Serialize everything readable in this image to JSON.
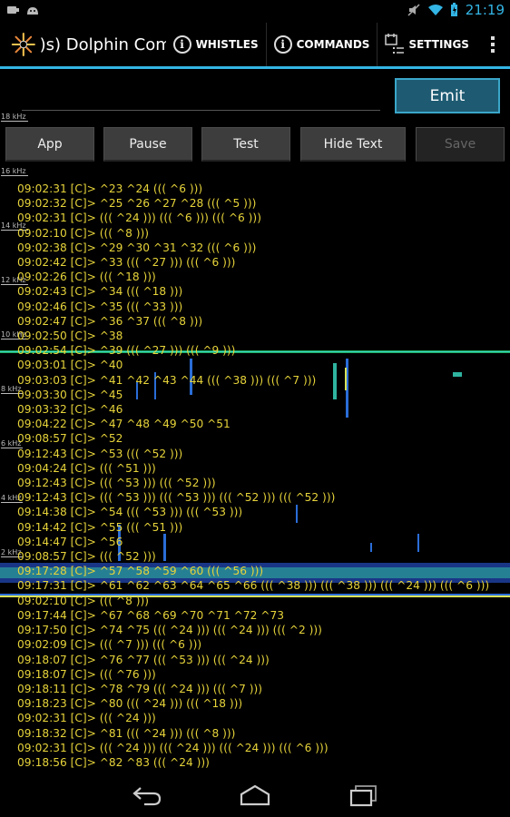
{
  "status_bar": {
    "time": "21:19",
    "left_icons": [
      "usb-debug-icon",
      "android-icon"
    ],
    "right_icons": [
      "mute-icon",
      "wifi-icon",
      "battery-icon"
    ]
  },
  "action_bar": {
    "title": ")s) Dolphin Com...",
    "whistles_label": "WHISTLES",
    "commands_label": "COMMANDS",
    "settings_label": "SETTINGS",
    "accent_color": "#33b5e5"
  },
  "input": {
    "value": ""
  },
  "emit_label": "Emit",
  "toolbar": {
    "app_label": "App",
    "pause_label": "Pause",
    "test_label": "Test",
    "hide_text_label": "Hide Text",
    "save_label": "Save"
  },
  "freq_labels": [
    "18 kHz",
    "16 kHz",
    "14 kHz",
    "12 kHz",
    "10 kHz",
    "8 kHz",
    "6 kHz",
    "4 kHz",
    "2 kHz"
  ],
  "log": [
    "09:02:31 [C]> ^23 ^24 ((( ^6 )))",
    "09:02:32 [C]> ^25 ^26 ^27 ^28 ((( ^5 )))",
    "09:02:31 [C]> ((( ^24 ))) ((( ^6 ))) ((( ^6 )))",
    "09:02:10 [C]> ((( ^8 )))",
    "09:02:38 [C]> ^29 ^30 ^31 ^32 ((( ^6 )))",
    "09:02:42 [C]> ^33 ((( ^27 ))) ((( ^6 )))",
    "09:02:26 [C]> ((( ^18 )))",
    "09:02:43 [C]> ^34 ((( ^18 )))",
    "09:02:46 [C]> ^35 ((( ^33 )))",
    "09:02:47 [C]> ^36 ^37 ((( ^8 )))",
    "09:02:50 [C]> ^38",
    "09:02:54 [C]> ^39 ((( ^27 ))) ((( ^9 )))",
    "09:03:01 [C]> ^40",
    "09:03:03 [C]> ^41 ^42 ^43 ^44 ((( ^38 ))) ((( ^7 )))",
    "09:03:30 [C]> ^45",
    "09:03:32 [C]> ^46",
    "09:04:22 [C]> ^47 ^48 ^49 ^50 ^51",
    "09:08:57 [C]> ^52",
    "09:12:43 [C]> ^53 ((( ^52 )))",
    "09:04:24 [C]> ((( ^51 )))",
    "09:12:43 [C]> ((( ^53 ))) ((( ^52 )))",
    "09:12:43 [C]> ((( ^53 ))) ((( ^53 ))) ((( ^52 ))) ((( ^52 )))",
    "09:14:38 [C]> ^54 ((( ^53 ))) ((( ^53 )))",
    "09:14:42 [C]> ^55 ((( ^51 )))",
    "09:14:47 [C]> ^56",
    "09:08:57 [C]> ((( ^52 )))",
    "09:17:28 [C]> ^57 ^58 ^59 ^60 ((( ^56 )))",
    "09:17:31 [C]> ^61 ^62 ^63 ^64 ^65 ^66 ((( ^38 ))) ((( ^38 ))) ((( ^24 ))) ((( ^6 )))",
    "09:02:10 [C]> ((( ^8 )))",
    "09:17:44 [C]> ^67 ^68 ^69 ^70 ^71 ^72 ^73",
    "09:17:50 [C]> ^74 ^75 ((( ^24 ))) ((( ^24 ))) ((( ^2 )))",
    "09:02:09 [C]> ((( ^7 ))) ((( ^6 )))",
    "09:18:07 [C]> ^76 ^77 ((( ^53 ))) ((( ^24 )))",
    "09:18:07 [C]> ((( ^76 )))",
    "09:18:11 [C]> ^78 ^79 ((( ^24 ))) ((( ^7 )))",
    "09:18:23 [C]> ^80 ((( ^24 ))) ((( ^18 )))",
    "09:02:31 [C]> ((( ^24 )))",
    "09:18:32 [C]> ^81 ((( ^24 ))) ((( ^8 )))",
    "09:02:31 [C]> ((( ^24 ))) ((( ^24 ))) ((( ^24 ))) ((( ^6 )))",
    "09:18:56 [C]> ^82 ^83 ((( ^24 )))"
  ],
  "log_color": "#e6d33a",
  "nav": {
    "icons": [
      "back-icon",
      "home-icon",
      "recent-apps-icon"
    ]
  }
}
